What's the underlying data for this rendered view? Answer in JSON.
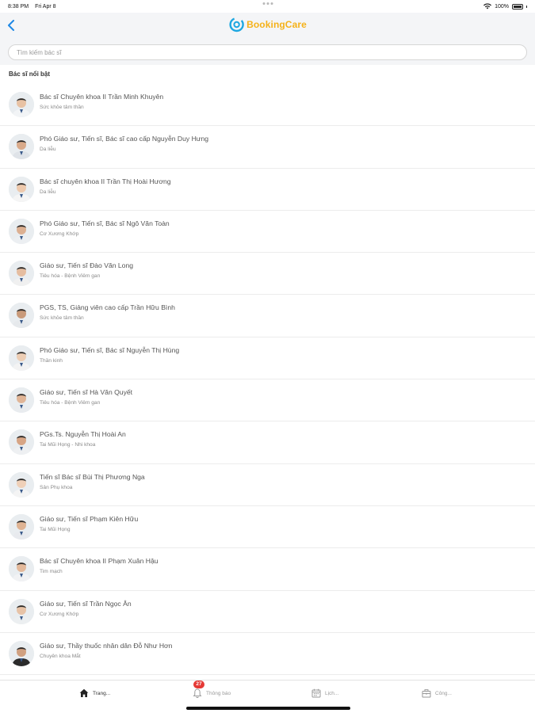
{
  "status_bar": {
    "time": "8:38 PM",
    "date": "Fri Apr 8",
    "battery": "100%"
  },
  "header": {
    "back_icon": "chevron-left-icon",
    "brand": "BookingCare",
    "brand_color": "#f5b21a",
    "accent_color": "#1ea7e1"
  },
  "search": {
    "placeholder": "Tìm kiếm bác sĩ",
    "value": ""
  },
  "section": {
    "title": "Bác sĩ nổi bật"
  },
  "doctors": [
    {
      "name": "Bác sĩ Chuyên khoa II Trần Minh Khuyên",
      "specialty": "Sức khỏe tâm thần"
    },
    {
      "name": "Phó Giáo sư, Tiến sĩ, Bác sĩ cao cấp Nguyễn Duy Hưng",
      "specialty": "Da liễu"
    },
    {
      "name": "Bác sĩ chuyên khoa II Trần Thị Hoài Hương",
      "specialty": "Da liễu"
    },
    {
      "name": "Phó Giáo sư, Tiến sĩ, Bác sĩ Ngô Văn Toàn",
      "specialty": "Cơ Xương Khớp"
    },
    {
      "name": "Giáo sư, Tiến sĩ Đào Văn Long",
      "specialty": "Tiêu hóa - Bệnh Viêm gan"
    },
    {
      "name": "PGS, TS, Giảng viên cao cấp Trần Hữu Bình",
      "specialty": "Sức khỏe tâm thần"
    },
    {
      "name": "Phó Giáo sư, Tiến sĩ, Bác sĩ Nguyễn Thị Hùng",
      "specialty": "Thần kinh"
    },
    {
      "name": "Giáo sư, Tiến sĩ Hà Văn Quyết",
      "specialty": "Tiêu hóa - Bệnh Viêm gan"
    },
    {
      "name": "PGs.Ts. Nguyễn Thị Hoài An",
      "specialty": "Tai Mũi Họng - Nhi khoa"
    },
    {
      "name": "Tiến sĩ Bác sĩ Bùi Thị Phương Nga",
      "specialty": "Sản Phụ khoa"
    },
    {
      "name": "Giáo sư, Tiến sĩ Phạm Kiên Hữu",
      "specialty": "Tai Mũi Họng"
    },
    {
      "name": "Bác sĩ Chuyên khoa II Phạm Xuân Hậu",
      "specialty": "Tim mạch"
    },
    {
      "name": "Giáo sư, Tiến sĩ Trần Ngọc Ân",
      "specialty": "Cơ Xương Khớp"
    },
    {
      "name": "Giáo sư, Thầy thuốc nhân dân Đỗ Như Hơn",
      "specialty": "Chuyên khoa Mắt"
    }
  ],
  "tabbar": {
    "home": {
      "label": "Trang...",
      "icon": "home-icon"
    },
    "notifications": {
      "label": "Thông báo",
      "icon": "bell-icon",
      "badge": "27",
      "badge_color": "#e53935"
    },
    "calendar": {
      "label": "Lịch...",
      "icon": "calendar-icon"
    },
    "tools": {
      "label": "Công...",
      "icon": "toolbox-icon"
    }
  }
}
